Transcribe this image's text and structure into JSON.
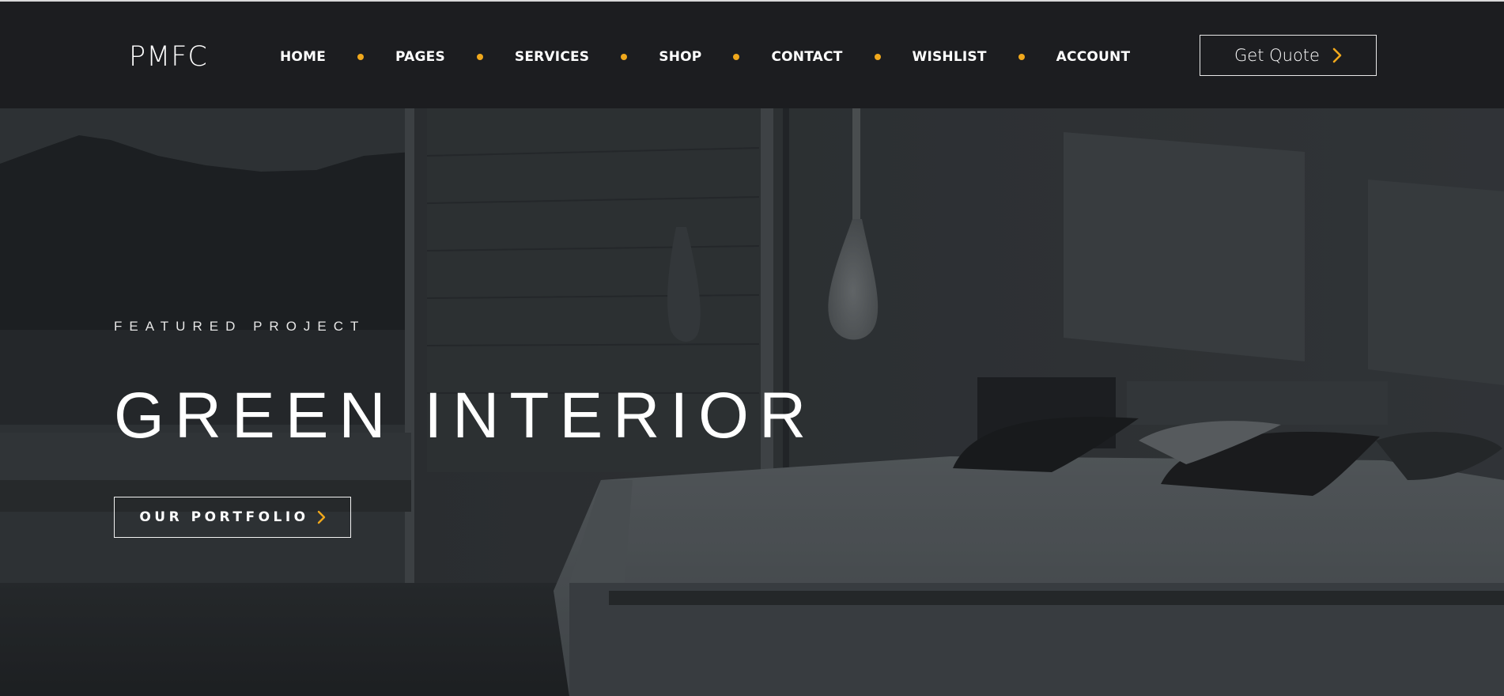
{
  "header": {
    "logo": "PMFC",
    "nav": [
      {
        "label": "HOME"
      },
      {
        "label": "PAGES"
      },
      {
        "label": "SERVICES"
      },
      {
        "label": "SHOP"
      },
      {
        "label": "CONTACT"
      },
      {
        "label": "WISHLIST"
      },
      {
        "label": "ACCOUNT"
      }
    ],
    "cta_label": "Get Quote",
    "cta_icon": "chevron-right-icon"
  },
  "hero": {
    "eyebrow": "FEATURED PROJECT",
    "title": "GREEN INTERIOR",
    "button_label": "OUR PORTFOLIO",
    "button_icon": "chevron-right-icon",
    "background": "dark bedroom photo with window view of hills"
  },
  "colors": {
    "header_bg": "#1c1d20",
    "accent": "#f0a81c",
    "text": "#ffffff",
    "hero_overlay": "#2e3134"
  }
}
